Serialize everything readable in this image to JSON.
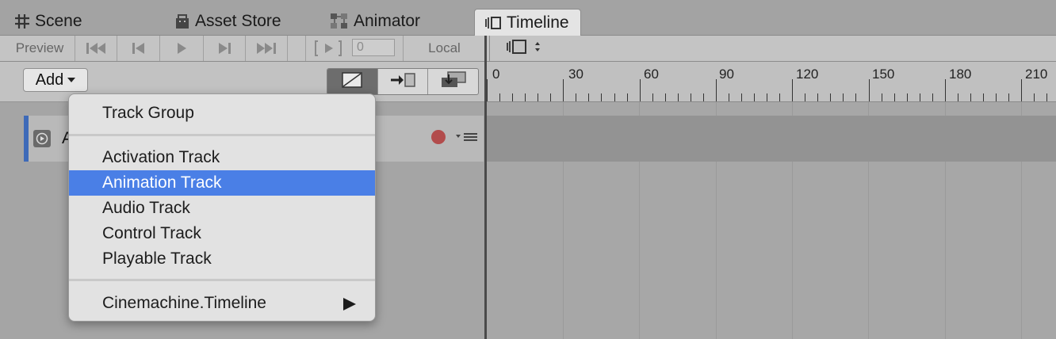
{
  "tabs": [
    {
      "label": "Scene",
      "icon": "grid-icon"
    },
    {
      "label": "Asset Store",
      "icon": "store-bag-icon"
    },
    {
      "label": "Animator",
      "icon": "animator-nodes-icon"
    },
    {
      "label": "Timeline",
      "icon": "timeline-icon",
      "active": true
    }
  ],
  "toolbar": {
    "preview_label": "Preview",
    "frame_value": "0",
    "space_label": "Local",
    "buttons": [
      "go-to-start-icon",
      "previous-frame-icon",
      "play-icon",
      "next-frame-icon",
      "go-to-end-icon",
      "play-range-icon"
    ]
  },
  "header": {
    "add_label": "Add",
    "edit_modes": [
      "mix-mode-icon",
      "ripple-mode-icon",
      "replace-mode-icon"
    ]
  },
  "track": {
    "name": "A",
    "icon": "animation-track-icon",
    "record_color": "#b24c4c",
    "accent_color": "#3e6ab8"
  },
  "ruler": {
    "labels": [
      "0",
      "30",
      "60",
      "90",
      "120",
      "150",
      "180",
      "210"
    ]
  },
  "menu": {
    "groups": [
      [
        "Track Group"
      ],
      [
        "Activation Track",
        "Animation Track",
        "Audio Track",
        "Control Track",
        "Playable Track"
      ],
      [
        "Cinemachine.Timeline"
      ]
    ],
    "selected": "Animation Track",
    "selected_color": "#4a7fe6",
    "submenu_item": "Cinemachine.Timeline"
  }
}
